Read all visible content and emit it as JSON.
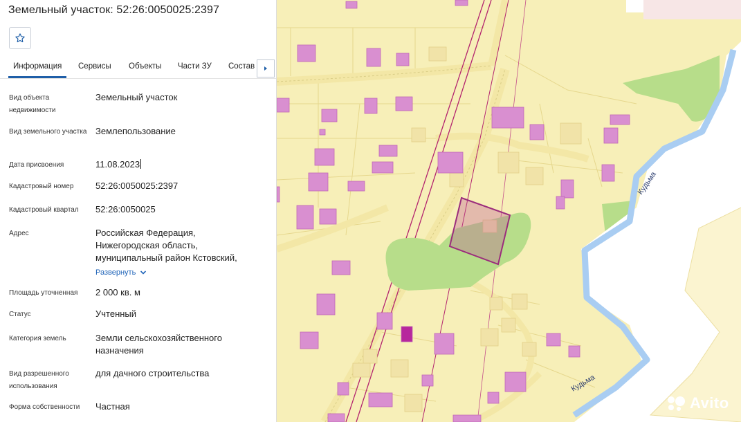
{
  "panel": {
    "title": "Земельный участок: 52:26:0050025:2397",
    "tabs": [
      "Информация",
      "Сервисы",
      "Объекты",
      "Части ЗУ",
      "Состав"
    ],
    "fields": [
      {
        "label": "Вид объекта недвижимости",
        "value": "Земельный участок"
      },
      {
        "label": "Вид земельного участка",
        "value": "Землепользование"
      },
      {
        "label": "Дата присвоения",
        "value": "11.08.2023"
      },
      {
        "label": "Кадастровый номер",
        "value": "52:26:0050025:2397"
      },
      {
        "label": "Кадастровый квартал",
        "value": "52:26:0050025"
      },
      {
        "label": "Адрес",
        "value": "Российская Федерация, Нижегородская область, муниципальный район Кстовский,"
      },
      {
        "label": "Площадь уточненная",
        "value": "2 000 кв. м"
      },
      {
        "label": "Статус",
        "value": "Учтенный"
      },
      {
        "label": "Категория земель",
        "value": "Земли сельскохозяйственного назначения"
      },
      {
        "label": "Вид разрешенного использования",
        "value": "для дачного строительства"
      },
      {
        "label": "Форма собственности",
        "value": "Частная"
      }
    ],
    "expand_label": "Развернуть"
  },
  "map": {
    "river_labels": [
      "Кудьма",
      "Кудьма"
    ],
    "watermark": "Avito"
  },
  "colors": {
    "map_background": "#f7efb8",
    "building": "#d98fd0",
    "parcel_selected": "#b24a8e",
    "greenery": "#b7dd8a",
    "river": "#a9cdf2",
    "accent": "#1f5fa8"
  }
}
